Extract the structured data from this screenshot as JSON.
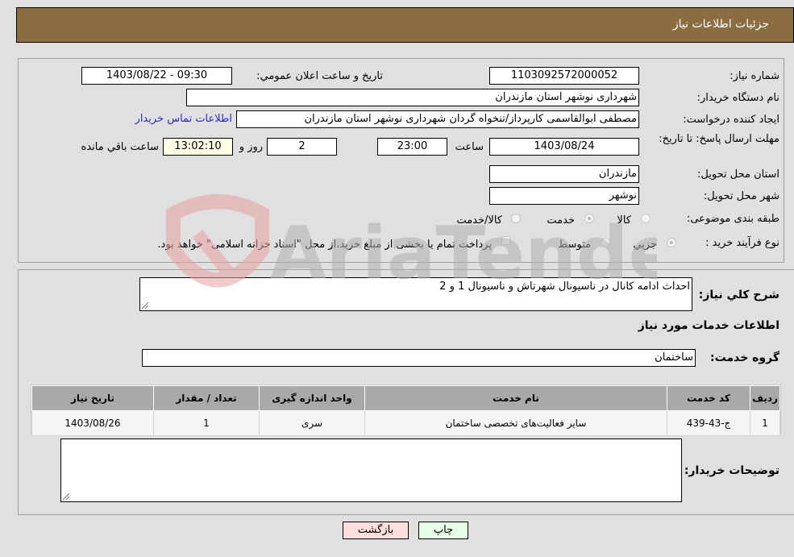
{
  "header": {
    "title": "جزئیات اطلاعات نیاز"
  },
  "form": {
    "need_number": {
      "label": "شماره نیاز:",
      "value": "1103092572000052"
    },
    "announce_datetime": {
      "label": "تاریخ و ساعت اعلان عمومي:",
      "value": "1403/08/22 - 09:30"
    },
    "buyer_org": {
      "label": "نام دستگاه خریدار:",
      "value": "شهرداری نوشهر استان مازندران"
    },
    "requester": {
      "label": "ایجاد کننده درخواست:",
      "value": "مصطفی  ابوالقاسمی کارپرداز/تنخواه گردان شهرداری نوشهر استان مازندران",
      "contact_link": "اطلاعات تماس خریدار"
    },
    "deadline": {
      "label": "مهلت ارسال پاسخ: تا تاریخ:",
      "date": "1403/08/24",
      "time_label": "ساعت",
      "time": "23:00",
      "days": "2",
      "days_label": "روز و",
      "remaining": "13:02:10",
      "remaining_label": "ساعت باقي مانده"
    },
    "province": {
      "label": "استان محل تحویل:",
      "value": "مازندران"
    },
    "city": {
      "label": "شهر محل تحویل:",
      "value": "نوشهر"
    },
    "category": {
      "label": "طبقه بندی موضوعی:",
      "options": [
        {
          "label": "کالا",
          "checked": false
        },
        {
          "label": "خدمت",
          "checked": true
        },
        {
          "label": "کالا/خدمت",
          "checked": false
        }
      ]
    },
    "purchase_type": {
      "label": "نوع فرآیند خرید :",
      "options": [
        {
          "label": "جزيي",
          "checked": true
        },
        {
          "label": "متوسط",
          "checked": false
        }
      ],
      "treasury_note": "پرداخت تمام یا بخشی از مبلغ خرید،از محل \"اسناد خزانه اسلامی\" خواهد بود."
    }
  },
  "details": {
    "description_label": "شرح کلي نياز:",
    "description": "احداث ادامه کانال در ناسیونال شهرتاش و ناسیونال 1 و 2",
    "services_heading": "اطلاعات خدمات مورد نیاز",
    "service_group_label": "گروه خدمت:",
    "service_group": "ساختمان",
    "table": {
      "headers": [
        "ردیف",
        "کد خدمت",
        "نام خدمت",
        "واحد اندازه گیری",
        "تعداد / مقدار",
        "تاریخ نیاز"
      ],
      "rows": [
        [
          "1",
          "ج-43-439",
          "سایر فعالیت‌های تخصصی ساختمان",
          "سری",
          "1",
          "1403/08/26"
        ]
      ]
    },
    "buyer_notes_label": "توضیحات خریدار:",
    "buyer_notes": ""
  },
  "buttons": {
    "print": "چاپ",
    "back": "بازگشت"
  },
  "watermark": {
    "text": "AriaTender.neT"
  },
  "colors": {
    "header_bg": "#8b6d42",
    "print_bg": "#e6ffe6",
    "back_bg": "#ffdede",
    "link": "#2a2acc"
  }
}
